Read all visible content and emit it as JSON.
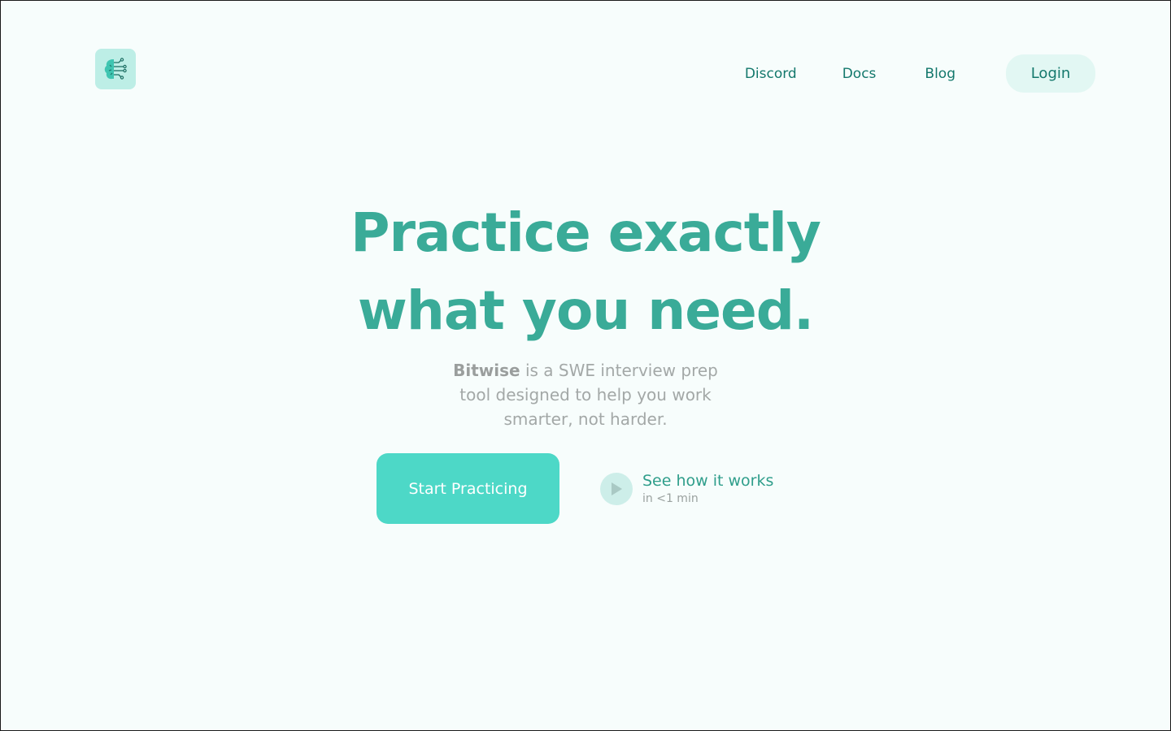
{
  "header": {
    "logo_icon": "brain-circuit-icon",
    "nav": {
      "discord": "Discord",
      "docs": "Docs",
      "blog": "Blog"
    },
    "login_label": "Login"
  },
  "hero": {
    "headline_line1": "Practice exactly",
    "headline_line2": "what you need.",
    "brand": "Bitwise",
    "sub_after_brand": " is a SWE interview prep tool designed to help you work smarter, not harder.",
    "cta_label": "Start Practicing",
    "watch_title": "See how it works",
    "watch_sub": "in <1 min",
    "watch_icon": "play-icon"
  },
  "colors": {
    "brand_teal": "#3aab98",
    "button_teal": "#4dd8c7",
    "nav_text": "#13786c",
    "background": "#f7fdfc"
  }
}
